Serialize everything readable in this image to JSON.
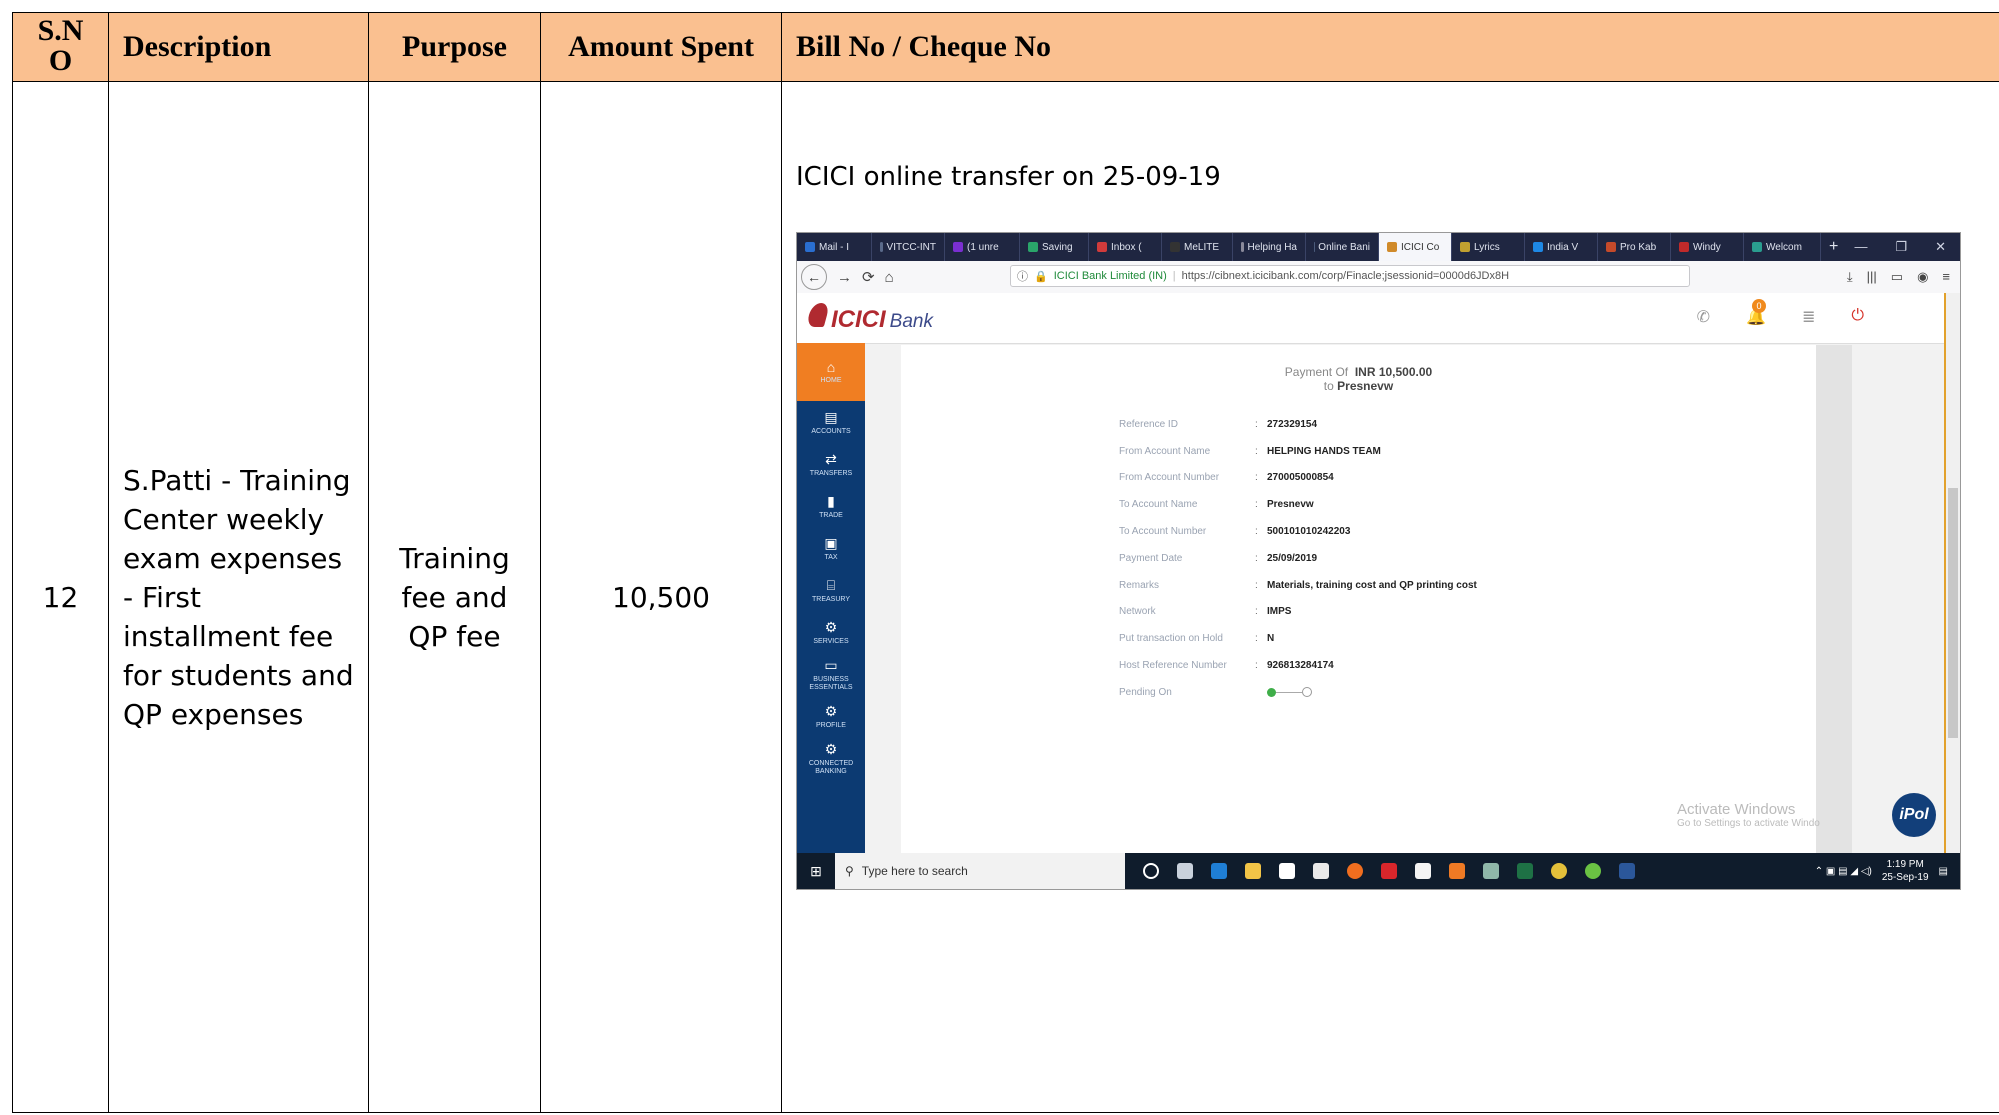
{
  "table": {
    "headers": {
      "sno": "S.N O",
      "description": "Description",
      "purpose": "Purpose",
      "amount": "Amount Spent",
      "bill": "Bill No / Cheque No"
    },
    "row": {
      "sno": "12",
      "description": "S.Patti - Training Center weekly exam expenses - First installment fee for students and QP expenses",
      "purpose": "Training fee and QP fee",
      "amount": "10,500",
      "bill_caption": "ICICI online transfer on 25-09-19"
    }
  },
  "screenshot": {
    "tabs": [
      "Mail - I",
      "VITCC-INT",
      "(1 unre",
      "Saving",
      "Inbox (",
      "MeLITE",
      "Helping Ha",
      "Online Bani",
      "ICICI Co",
      "Lyrics",
      "India V",
      "Pro Kab",
      "Windy",
      "Welcom"
    ],
    "url_site": "ICICI Bank Limited (IN)",
    "url": "https://cibnext.icicibank.com/corp/Finacle;jsessionid=0000d6JDx8H",
    "bank": {
      "logo_icici": "ICICI",
      "logo_bank": "Bank",
      "notif_count": "0"
    },
    "nav": [
      {
        "label": "HOME",
        "icon": "home-icon"
      },
      {
        "label": "ACCOUNTS",
        "icon": "accounts-icon"
      },
      {
        "label": "TRANSFERS",
        "icon": "transfers-icon"
      },
      {
        "label": "TRADE",
        "icon": "trade-icon"
      },
      {
        "label": "TAX",
        "icon": "tax-icon"
      },
      {
        "label": "TREASURY",
        "icon": "treasury-icon"
      },
      {
        "label": "SERVICES",
        "icon": "services-icon"
      },
      {
        "label": "BUSINESS ESSENTIALS",
        "icon": "business-icon"
      },
      {
        "label": "PROFILE",
        "icon": "profile-icon"
      },
      {
        "label": "CONNECTED BANKING",
        "icon": "connected-icon"
      }
    ],
    "payment": {
      "title_prefix": "Payment Of",
      "amount": "INR 10,500.00",
      "to_prefix": "to",
      "to_name": "Presnevw",
      "fields": [
        {
          "label": "Reference ID",
          "value": "272329154"
        },
        {
          "label": "From Account Name",
          "value": "HELPING HANDS TEAM"
        },
        {
          "label": "From Account Number",
          "value": "270005000854"
        },
        {
          "label": "To Account Name",
          "value": "Presnevw"
        },
        {
          "label": "To Account Number",
          "value": "500101010242203"
        },
        {
          "label": "Payment Date",
          "value": "25/09/2019"
        },
        {
          "label": "Remarks",
          "value": "Materials, training cost and QP printing cost"
        },
        {
          "label": "Network",
          "value": "IMPS"
        },
        {
          "label": "Put transaction on Hold",
          "value": "N"
        },
        {
          "label": "Host Reference Number",
          "value": "926813284174"
        }
      ],
      "pending_label": "Pending On"
    },
    "watermark": {
      "line1": "Activate Windows",
      "line2": "Go to Settings to activate Windo"
    },
    "ipol": "iPol",
    "taskbar": {
      "search": "Type here to search",
      "time": "1:19 PM",
      "date": "25-Sep-19"
    }
  }
}
